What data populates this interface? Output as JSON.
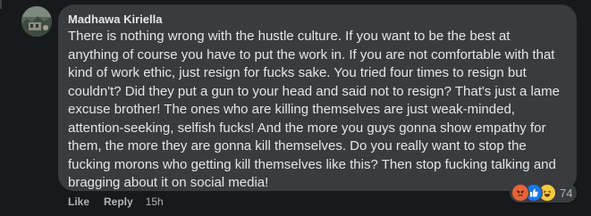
{
  "comment": {
    "author": "Madhawa Kiriella",
    "lines": [
      "There is nothing wrong with the hustle culture. If you want to be the best at",
      "anything of course you have to put the work in. If you are not comfortable with that",
      "kind of work ethic, just resign for fucks sake. You tried four times to resign but",
      "couldn't? Did they put a gun to your head and said not to resign? That's just a lame",
      "excuse brother! The ones who are killing themselves are just weak-minded,",
      "attention-seeking, selfish fucks! And the more you guys gonna show empathy for",
      "them, the more they are gonna kill themselves. Do you really want to stop the",
      "fucking morons who getting kill themselves like this? Then stop fucking talking and",
      "bragging about it on social media!"
    ],
    "reactions": {
      "icons": [
        "angry-reaction",
        "like-reaction",
        "haha-reaction"
      ],
      "count": "74"
    },
    "actions": {
      "like_label": "Like",
      "reply_label": "Reply",
      "timestamp": "15h"
    }
  },
  "colors": {
    "page_bg": "#18191a",
    "bubble_bg": "#3a3b3c",
    "primary_text": "#e4e6eb",
    "secondary_text": "#b0b3b8",
    "like_blue": "#1877f2",
    "angry_orange": "#e7633a",
    "haha_yellow": "#f7c93c"
  }
}
